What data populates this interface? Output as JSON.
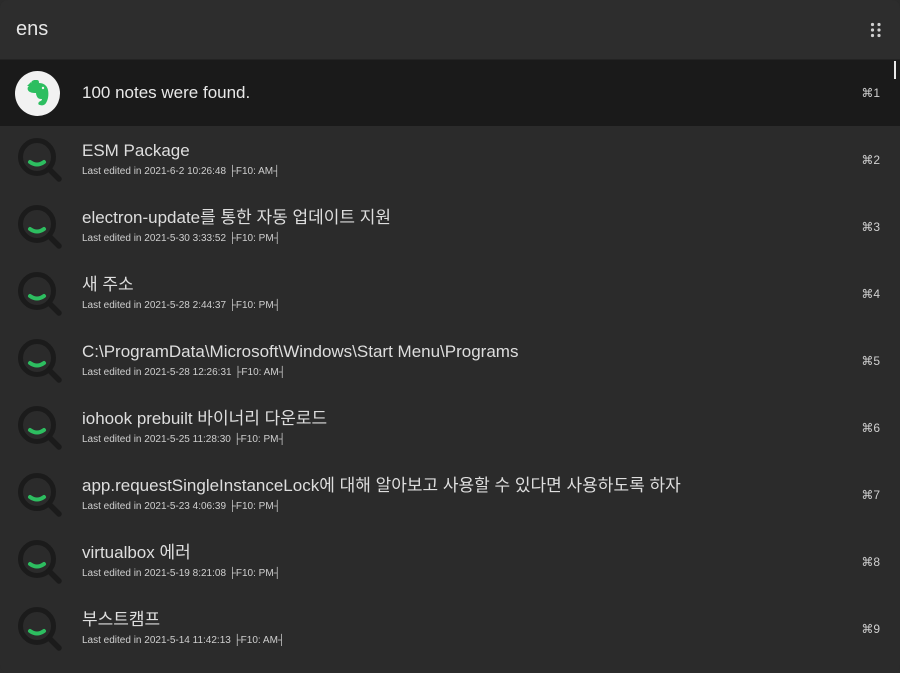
{
  "search": {
    "value": "ens"
  },
  "results": [
    {
      "icon": "evernote-elephant-icon",
      "title": "100 notes were found.",
      "subtitle": "",
      "shortcut": "⌘1"
    },
    {
      "icon": "search-icon",
      "title": "ESM Package",
      "subtitle": "Last edited in 2021-6-2 10:26:48 ├F10: AM┤",
      "shortcut": "⌘2"
    },
    {
      "icon": "search-icon",
      "title": "electron-update를 통한 자동 업데이트 지원",
      "subtitle": "Last edited in 2021-5-30 3:33:52 ├F10: PM┤",
      "shortcut": "⌘3"
    },
    {
      "icon": "search-icon",
      "title": "새 주소",
      "subtitle": "Last edited in 2021-5-28 2:44:37 ├F10: PM┤",
      "shortcut": "⌘4"
    },
    {
      "icon": "search-icon",
      "title": "C:\\ProgramData\\Microsoft\\Windows\\Start Menu\\Programs",
      "subtitle": "Last edited in 2021-5-28 12:26:31 ├F10: AM┤",
      "shortcut": "⌘5"
    },
    {
      "icon": "search-icon",
      "title": "iohook prebuilt 바이너리 다운로드",
      "subtitle": "Last edited in 2021-5-25 11:28:30 ├F10: PM┤",
      "shortcut": "⌘6"
    },
    {
      "icon": "search-icon",
      "title": "app.requestSingleInstanceLock에 대해 알아보고 사용할 수 있다면 사용하도록 하자",
      "subtitle": "Last edited in 2021-5-23 4:06:39 ├F10: PM┤",
      "shortcut": "⌘7"
    },
    {
      "icon": "search-icon",
      "title": "virtualbox 에러",
      "subtitle": "Last edited in 2021-5-19 8:21:08 ├F10: PM┤",
      "shortcut": "⌘8"
    },
    {
      "icon": "search-icon",
      "title": "부스트캠프",
      "subtitle": "Last edited in 2021-5-14 11:42:13 ├F10: AM┤",
      "shortcut": "⌘9"
    }
  ],
  "colors": {
    "background": "#2b2b2b",
    "selected": "#1a1a1a",
    "accent": "#2dbe60",
    "icon_ring": "#1b1b1b"
  }
}
